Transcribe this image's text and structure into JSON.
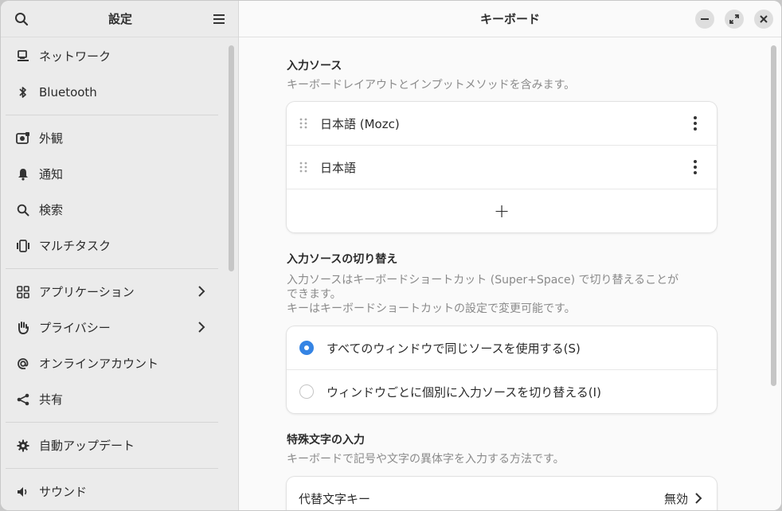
{
  "sidebar": {
    "title": "設定",
    "items": [
      {
        "label": "ネットワーク",
        "icon": "network-icon"
      },
      {
        "label": "Bluetooth",
        "icon": "bluetooth-icon"
      },
      {
        "label": "外観",
        "icon": "appearance-icon"
      },
      {
        "label": "通知",
        "icon": "bell-icon"
      },
      {
        "label": "検索",
        "icon": "search-icon"
      },
      {
        "label": "マルチタスク",
        "icon": "multitasking-icon"
      },
      {
        "label": "アプリケーション",
        "icon": "apps-grid-icon"
      },
      {
        "label": "プライバシー",
        "icon": "hand-icon"
      },
      {
        "label": "オンラインアカウント",
        "icon": "at-icon"
      },
      {
        "label": "共有",
        "icon": "share-icon"
      },
      {
        "label": "自動アップデート",
        "icon": "gear-icon"
      },
      {
        "label": "サウンド",
        "icon": "speaker-icon"
      }
    ]
  },
  "main": {
    "title": "キーボード",
    "input_sources": {
      "title": "入力ソース",
      "description": "キーボードレイアウトとインプットメソッドを含みます。",
      "sources": [
        "日本語 (Mozc)",
        "日本語"
      ],
      "add_label": "+"
    },
    "switching": {
      "title": "入力ソースの切り替え",
      "description_1": "入力ソースはキーボードショートカット (Super+Space) で切り替えることが",
      "description_2": "できます。",
      "description_3": "キーはキーボードショートカットの設定で変更可能です。",
      "options": [
        {
          "label": "すべてのウィンドウで同じソースを使用する(S)",
          "selected": true
        },
        {
          "label": "ウィンドウごとに個別に入力ソースを切り替える(I)",
          "selected": false
        }
      ]
    },
    "special_chars": {
      "title": "特殊文字の入力",
      "description": "キーボードで記号や文字の異体字を入力する方法です。",
      "alt_key_label": "代替文字キー",
      "alt_key_value": "無効"
    }
  },
  "colors": {
    "accent": "#3584e4",
    "sidebar_bg": "#ebebeb",
    "content_bg": "#fafafa"
  }
}
